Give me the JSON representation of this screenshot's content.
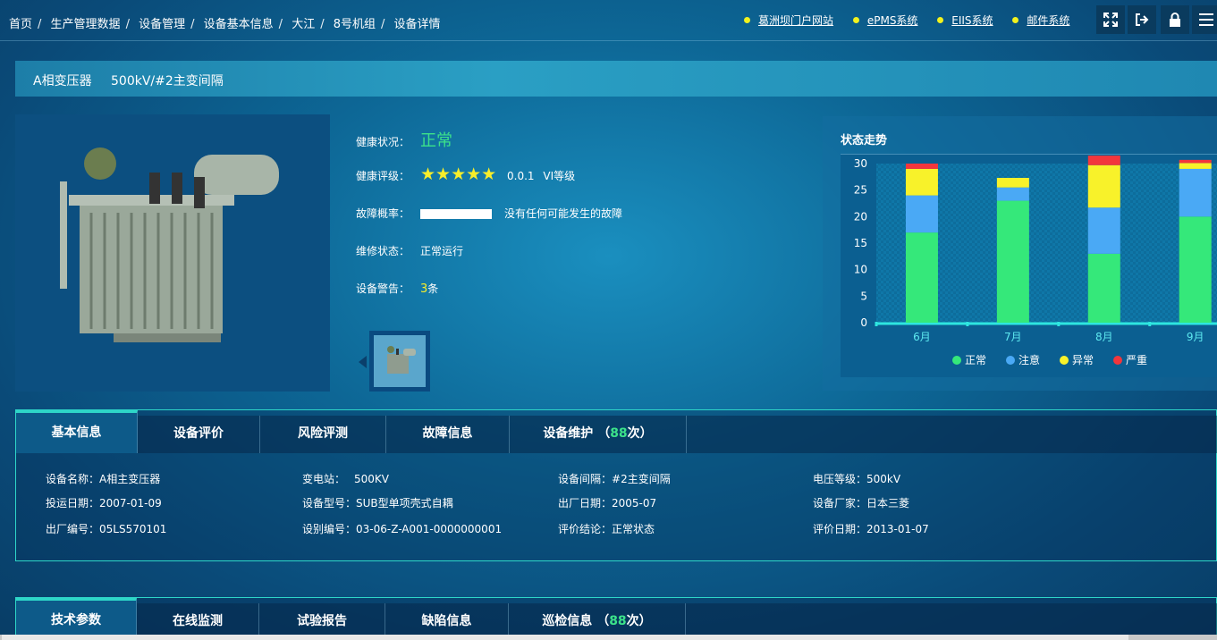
{
  "breadcrumb": [
    "首页",
    "生产管理数据",
    "设备管理",
    "设备基本信息",
    "大江",
    "8号机组",
    "设备详情"
  ],
  "links": [
    "葛洲坝门户网站",
    "ePMS系统",
    "EIIS系统",
    "邮件系统"
  ],
  "tools": [
    "fullscreen-icon",
    "logout-icon",
    "lock-icon",
    "menu-icon"
  ],
  "title": {
    "device": "A相变压器",
    "bay": "500kV/#2主变间隔"
  },
  "info": {
    "health_label": "健康状况：",
    "health_value": "正常",
    "rating_label": "健康评级：",
    "rating_stars": "★★★★★",
    "rating_score": "0.0.1",
    "rating_level": "VI等级",
    "fault_label": "故障概率：",
    "fault_text": "没有任何可能发生的故障",
    "maint_label": "维修状态：",
    "maint_value": "正常运行",
    "warn_label": "设备警告：",
    "warn_count": "3",
    "warn_unit": "条"
  },
  "chart_data": {
    "type": "bar",
    "title": "状态走势",
    "categories": [
      "6月",
      "7月",
      "8月",
      "9月"
    ],
    "stacked": true,
    "ylim": [
      0,
      30
    ],
    "yticks": [
      0,
      5,
      10,
      15,
      20,
      25,
      30
    ],
    "legend_position": "bottom",
    "series": [
      {
        "name": "正常",
        "color": "#35e87a",
        "values": [
          17,
          23,
          13,
          20
        ]
      },
      {
        "name": "注意",
        "color": "#4aa9f5",
        "values": [
          7,
          2.5,
          8.7,
          9
        ]
      },
      {
        "name": "异常",
        "color": "#f8f22a",
        "values": [
          5,
          1.8,
          8,
          1.1
        ]
      },
      {
        "name": "严重",
        "color": "#f2363c",
        "values": [
          1,
          0,
          1.8,
          0.6
        ]
      }
    ]
  },
  "tabs1": [
    {
      "label": "基本信息"
    },
    {
      "label": "设备评价"
    },
    {
      "label": "风险评测"
    },
    {
      "label": "故障信息"
    },
    {
      "label": "设备维护",
      "count_prefix": "（",
      "count": "88",
      "count_suffix": "次）"
    }
  ],
  "fields": [
    {
      "label": "设备名称：",
      "value": "A相主变压器"
    },
    {
      "label": "变电站：",
      "value": "500KV"
    },
    {
      "label": "设备间隔：",
      "value": "#2主变间隔"
    },
    {
      "label": "电压等级：",
      "value": "500kV"
    },
    {
      "label": "投运日期：",
      "value": "2007-01-09"
    },
    {
      "label": "设备型号：",
      "value": "SUB型单项壳式自耦"
    },
    {
      "label": "出厂日期：",
      "value": "2005-07"
    },
    {
      "label": "设备厂家：",
      "value": "日本三菱"
    },
    {
      "label": "出厂编号：",
      "value": "05LS570101"
    },
    {
      "label": "设别编号：",
      "value": "03-06-Z-A001-0000000001"
    },
    {
      "label": "评价结论：",
      "value": "正常状态"
    },
    {
      "label": "评价日期：",
      "value": "2013-01-07"
    }
  ],
  "tabs2": [
    {
      "label": "技术参数"
    },
    {
      "label": "在线监测"
    },
    {
      "label": "试验报告"
    },
    {
      "label": "缺陷信息"
    },
    {
      "label": "巡检信息",
      "count_prefix": "（",
      "count": "88",
      "count_suffix": "次）"
    }
  ]
}
